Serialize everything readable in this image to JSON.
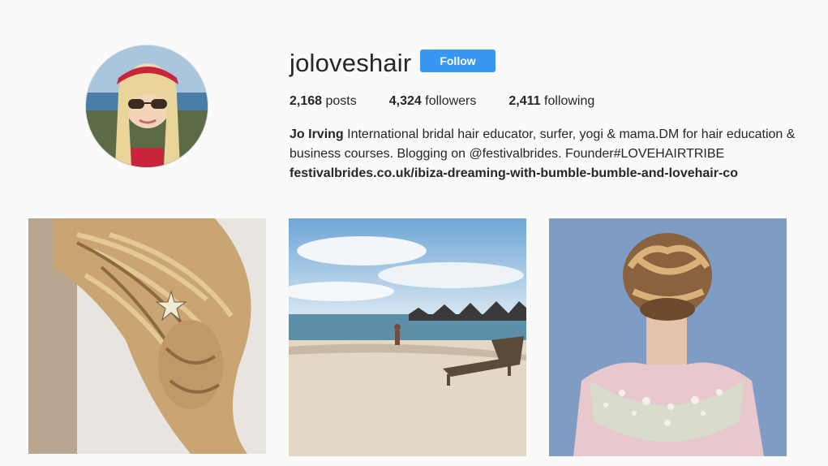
{
  "profile": {
    "username": "joloveshair",
    "follow_label": "Follow",
    "stats": {
      "posts_count": "2,168",
      "posts_label": "posts",
      "followers_count": "4,324",
      "followers_label": "followers",
      "following_count": "2,411",
      "following_label": "following"
    },
    "bio": {
      "name": "Jo Irving",
      "text": "International bridal hair educator, surfer, yogi & mama.DM for hair education & business courses. Blogging on @festivalbrides. Founder#LOVEHAIRTRIBE",
      "link": "festivalbrides.co.uk/ibiza-dreaming-with-bumble-bumble-and-lovehair-co"
    }
  },
  "posts": [
    {
      "subject": "blonde braided ponytail with star hairpin"
    },
    {
      "subject": "beach with woman and sun lounger"
    },
    {
      "subject": "braided updo with embellished gown"
    }
  ],
  "colors": {
    "background": "#fafafa",
    "follow_button": "#3897f0",
    "text": "#262626"
  }
}
